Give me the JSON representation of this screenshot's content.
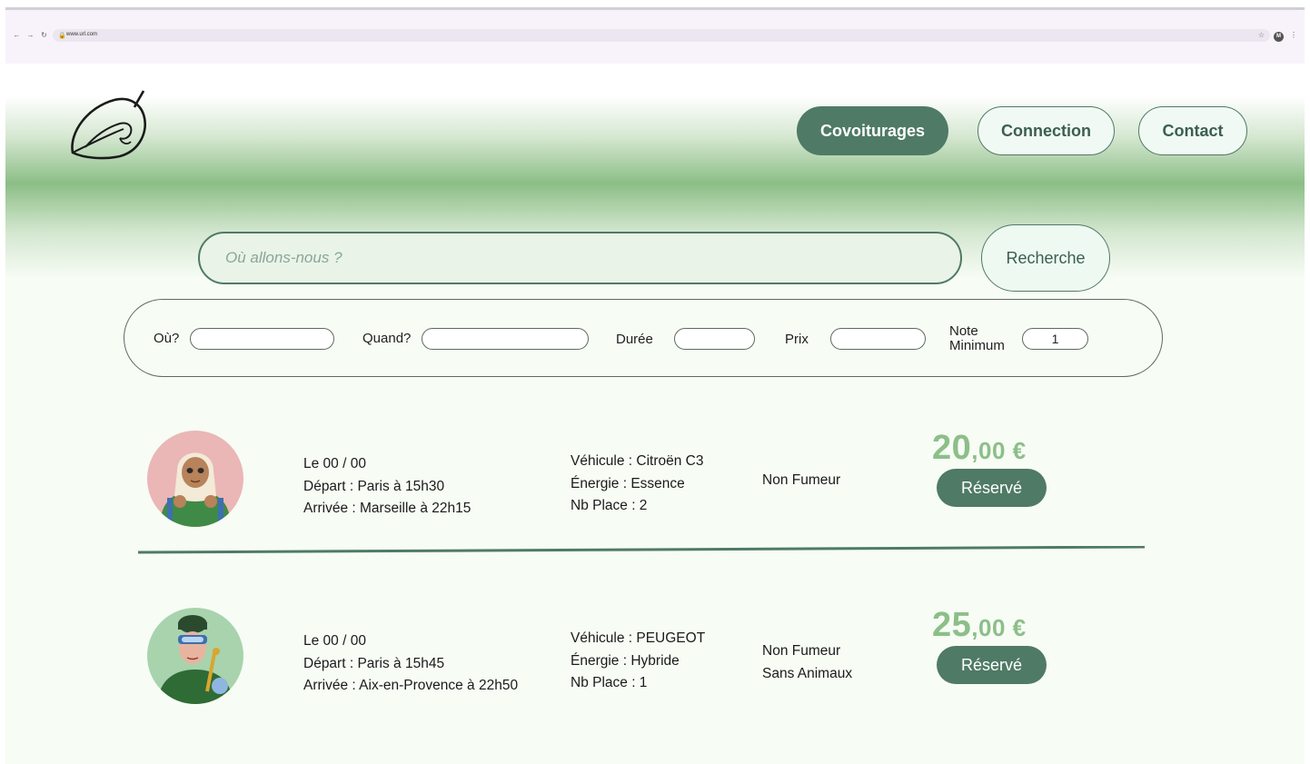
{
  "browser": {
    "url": "www.url.com",
    "profile_initial": "M"
  },
  "nav": {
    "covoiturages": "Covoiturages",
    "connection": "Connection",
    "contact": "Contact"
  },
  "search": {
    "placeholder": "Où allons-nous ?",
    "button": "Recherche"
  },
  "filters": {
    "where": "Où?",
    "when": "Quand?",
    "duration": "Durée",
    "price": "Prix",
    "rating_line1": "Note",
    "rating_line2": "Minimum",
    "rating_value": "1"
  },
  "rides": [
    {
      "date": "Le 00 / 00",
      "departure": "Départ : Paris à 15h30",
      "arrival": "Arrivée : Marseille à 22h15",
      "vehicle": "Véhicule : Citroën C3",
      "energy": "Énergie : Essence",
      "seats": "Nb Place : 2",
      "pref1": "Non Fumeur",
      "pref2": "",
      "price_int": "20",
      "price_dec": ",00 €",
      "button": "Réservé"
    },
    {
      "date": "Le 00 / 00",
      "departure": "Départ : Paris à 15h45",
      "arrival": "Arrivée : Aix-en-Provence à 22h50",
      "vehicle": "Véhicule : PEUGEOT",
      "energy": "Énergie : Hybride",
      "seats": "Nb Place : 1",
      "pref1": "Non Fumeur",
      "pref2": "Sans Animaux",
      "price_int": "25",
      "price_dec": ",00 €",
      "button": "Réservé"
    }
  ],
  "colors": {
    "primary": "#4f7a66",
    "price": "#8cbf88",
    "hero_mid": "#8cbe86"
  }
}
